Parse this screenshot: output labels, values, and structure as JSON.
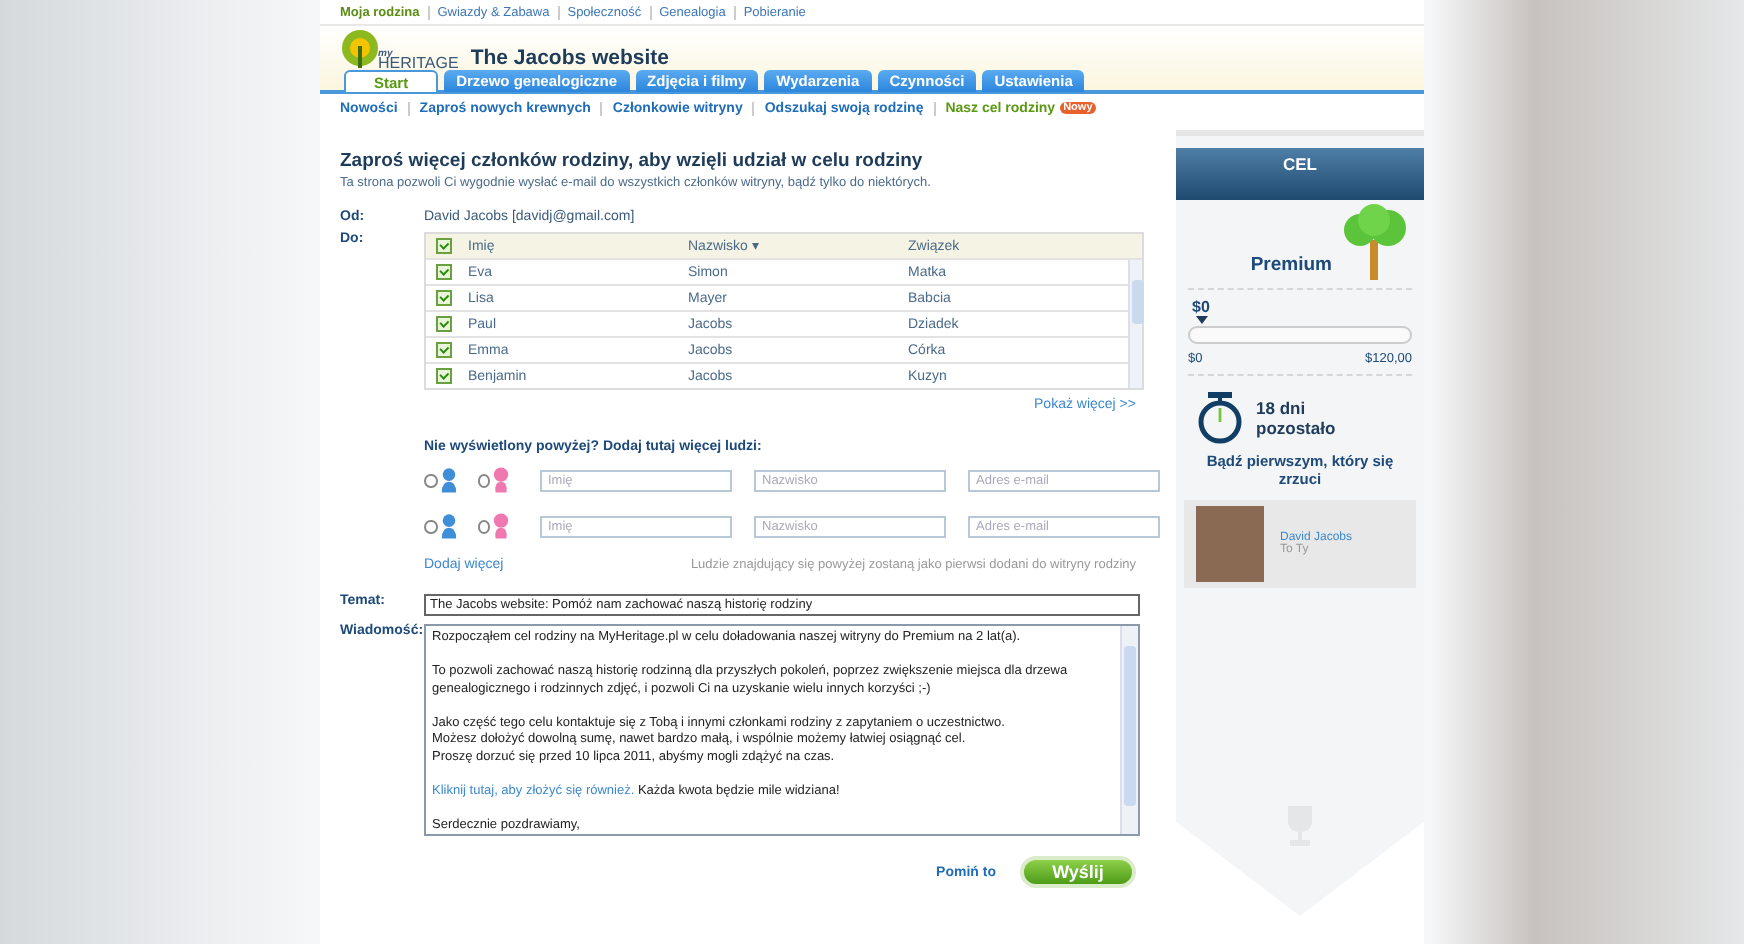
{
  "top_links": [
    {
      "label": "Moja rodzina",
      "selected": true
    },
    {
      "label": "Gwiazdy & Zabawa",
      "selected": false
    },
    {
      "label": "Społeczność",
      "selected": false
    },
    {
      "label": "Genealogia",
      "selected": false
    },
    {
      "label": "Pobieranie",
      "selected": false
    }
  ],
  "site": {
    "logo_small": "my",
    "logo": "HERITAGE",
    "title": "The Jacobs website"
  },
  "tabs": [
    {
      "label": "Start",
      "selected": true
    },
    {
      "label": "Drzewo genealogiczne",
      "selected": false
    },
    {
      "label": "Zdjęcia i filmy",
      "selected": false
    },
    {
      "label": "Wydarzenia",
      "selected": false
    },
    {
      "label": "Czynności",
      "selected": false
    },
    {
      "label": "Ustawienia",
      "selected": false
    }
  ],
  "subnav": [
    {
      "label": "Nowości",
      "selected": false
    },
    {
      "label": "Zaproś nowych krewnych",
      "selected": false
    },
    {
      "label": "Członkowie witryny",
      "selected": false
    },
    {
      "label": "Odszukaj swoją rodzinę",
      "selected": false
    },
    {
      "label": "Nasz cel rodziny",
      "selected": true,
      "badge": "Nowy"
    }
  ],
  "invite": {
    "heading": "Zaproś więcej członków rodziny, aby wzięli udział w celu rodziny",
    "subtitle": "Ta strona pozwoli Ci wygodnie wysłać e-mail do wszystkich członków witryny, bądź tylko do niektórych.",
    "from_label": "Od:",
    "from_value": "David Jacobs [davidj@gmail.com]",
    "to_label": "Do:",
    "table": {
      "all_checked": true,
      "columns": [
        "Imię",
        "Nazwisko ▾",
        "Związek"
      ],
      "rows": [
        {
          "checked": true,
          "cells": [
            "Eva",
            "Simon",
            "Matka"
          ]
        },
        {
          "checked": true,
          "cells": [
            "Lisa",
            "Mayer",
            "Babcia"
          ]
        },
        {
          "checked": true,
          "cells": [
            "Paul",
            "Jacobs",
            "Dziadek"
          ]
        },
        {
          "checked": true,
          "cells": [
            "Emma",
            "Jacobs",
            "Córka"
          ]
        },
        {
          "checked": true,
          "cells": [
            "Benjamin",
            "Jacobs",
            "Kuzyn"
          ]
        }
      ]
    },
    "show_more": "Pokaż więcej >>",
    "add_title": "Nie wyświetlony powyżej? Dodaj tutaj więcej ludzi:",
    "add_rows": [
      {
        "male_selected": false,
        "female_selected": false,
        "first_placeholder": "Imię",
        "last_placeholder": "Nazwisko",
        "email_placeholder": "Adres e-mail"
      },
      {
        "male_selected": false,
        "female_selected": false,
        "first_placeholder": "Imię",
        "last_placeholder": "Nazwisko",
        "email_placeholder": "Adres e-mail"
      }
    ],
    "add_more": "Dodaj więcej",
    "add_note": "Ludzie znajdujący się powyżej zostaną jako pierwsi dodani do witryny rodziny",
    "subject_label": "Temat:",
    "subject_value": "The Jacobs website: Pomóż nam zachować naszą historię rodziny",
    "message_label": "Wiadomość:",
    "message": [
      {
        "lines": [
          "Rozpocząłem cel rodziny na MyHeritage.pl w celu doładowania naszej witryny do Premium na 2 lat(a)."
        ]
      },
      {
        "lines": [
          "To pozwoli zachować naszą historię rodzinną dla przyszłych pokoleń, poprzez zwiększenie miejsca dla drzewa genealogicznego i rodzinnych zdjęć, i pozwoli Ci na uzyskanie wielu innych korzyści ;-)"
        ]
      },
      {
        "lines": [
          "Jako część tego celu kontaktuje się z Tobą i innymi członkami rodziny z zapytaniem o uczestnictwo.",
          "Możesz dołożyć dowolną sumę, nawet bardzo małą, i wspólnie możemy łatwiej osiągnąć cel.",
          "Proszę dorzuć się przed 10 lipca 2011, abyśmy mogli zdążyć na czas."
        ]
      },
      {
        "link": "Kliknij tutaj, aby złożyć się również.",
        "text": " Każda kwota będzie mile widziana!"
      },
      {
        "lines": [
          "Serdecznie pozdrawiamy,"
        ]
      }
    ],
    "skip": "Pomiń to",
    "send": "Wyślij"
  },
  "goal": {
    "title": "CEL",
    "plan": "Premium",
    "amount": "$0",
    "level": 0,
    "min": "$0",
    "max": "$120,00",
    "days": "18 dni",
    "days_note": "pozostało",
    "cta": "Bądź pierwszym, który się zrzuci",
    "supporter": {
      "name": "David Jacobs",
      "note": "To Ty"
    }
  }
}
